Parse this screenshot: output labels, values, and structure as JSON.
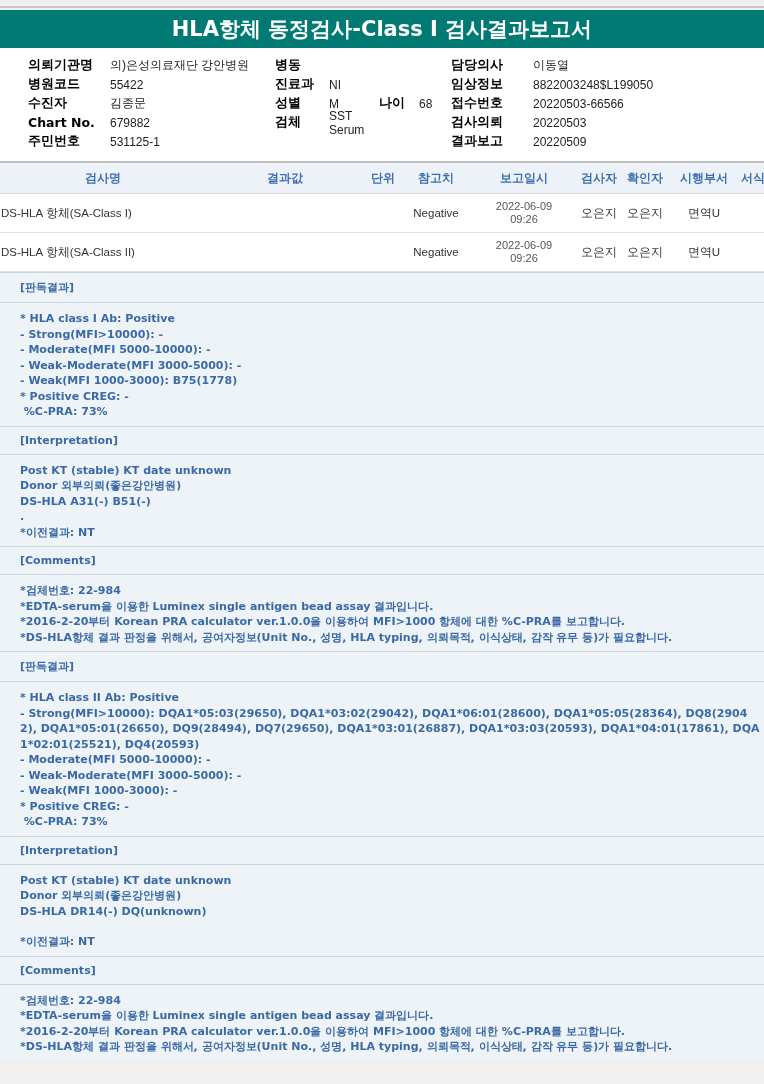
{
  "title": "HLA항체 동정검사-Class I 검사결과보고서",
  "info_rows": [
    {
      "left": {
        "label": "의뢰기관명",
        "value": "의)은성의료재단 강안병원"
      },
      "middle": {
        "label": "병동"
      },
      "right": {
        "label": "담당의사",
        "value": "이동열"
      }
    },
    {
      "left": {
        "label": "병원코드",
        "value": "55422"
      },
      "middle": {
        "label": "진료과",
        "value": "NI"
      },
      "right": {
        "label": "임상정보",
        "value": "8822003248$L199050"
      }
    },
    {
      "left": {
        "label": "수진자",
        "value": "김종문"
      },
      "middle": {
        "label": "성별",
        "value": "M",
        "extra": {
          "label": "나이",
          "value": "68"
        }
      },
      "right": {
        "label": "접수번호",
        "value": "20220503-66566"
      }
    },
    {
      "left": {
        "label": "Chart No.",
        "value": "679882"
      },
      "middle": {
        "label": "검체",
        "value": "SST Serum"
      },
      "right": {
        "label": "검사의뢰",
        "value": "20220503"
      }
    },
    {
      "left": {
        "label": "주민번호",
        "value": "531125-1"
      },
      "right": {
        "label": "결과보고",
        "value": "20220509"
      }
    }
  ],
  "table": {
    "columns": [
      "검사명",
      "결과값",
      "단위",
      "참고치",
      "보고일시",
      "검사자",
      "확인자",
      "시행부서",
      "서식"
    ],
    "rows": [
      {
        "name": "DS-HLA 항체(SA-Class I)",
        "reference": "Negative",
        "date": "2022-06-09",
        "time": "09:26",
        "tester": "오은지",
        "confirmer": "오은지",
        "department": "면역U"
      },
      {
        "name": "DS-HLA 항체(SA-Class II)",
        "reference": "Negative",
        "date": "2022-06-09",
        "time": "09:26",
        "tester": "오은지",
        "confirmer": "오은지",
        "department": "면역U"
      }
    ]
  },
  "sections": [
    {
      "heading": "[판독결과]",
      "paragraphs": [
        [
          "* HLA class I Ab: Positive",
          "- Strong(MFI>10000): -",
          "- Moderate(MFI 5000-10000): -",
          "- Weak-Moderate(MFI 3000-5000): -",
          "- Weak(MFI 1000-3000): B75(1778)",
          "* Positive CREG: -",
          " %C-PRA: 73%"
        ]
      ]
    },
    {
      "heading": "[Interpretation]",
      "paragraphs": [
        [
          "Post KT (stable) KT date unknown",
          "Donor 외부의뢰(좋은강안병원)",
          "DS-HLA A31(-) B51(-)",
          ".",
          "*이전결과: NT"
        ]
      ]
    },
    {
      "heading": "[Comments]",
      "paragraphs": [
        [
          "*검체번호: 22-984",
          "*EDTA-serum을 이용한 Luminex single antigen bead assay 결과입니다.",
          "*2016-2-20부터 Korean PRA calculator ver.1.0.0을 이용하여 MFI>1000 항체에 대한 %C-PRA를 보고합니다.",
          "*DS-HLA항체 결과 판정을 위해서, 공여자정보(Unit No., 성명, HLA typing, 의뢰목적, 이식상태, 감작 유무 등)가 필요합니다."
        ]
      ]
    },
    {
      "heading": "[판독결과]",
      "paragraphs": [
        [
          "* HLA class II Ab: Positive",
          "- Strong(MFI>10000): DQA1*05:03(29650), DQA1*03:02(29042), DQA1*06:01(28600), DQA1*05:05(28364), DQ8(29042), DQA1*05:01(26650), DQ9(28494), DQ7(29650), DQA1*03:01(26887), DQA1*03:03(20593), DQA1*04:01(17861), DQA1*02:01(25521), DQ4(20593)",
          "- Moderate(MFI 5000-10000): -",
          "- Weak-Moderate(MFI 3000-5000): -",
          "- Weak(MFI 1000-3000): -",
          "* Positive CREG: -",
          " %C-PRA: 73%"
        ]
      ]
    },
    {
      "heading": "[Interpretation]",
      "paragraphs": [
        [
          "Post KT (stable) KT date unknown",
          "Donor 외부의뢰(좋은강안병원)",
          "DS-HLA DR14(-) DQ(unknown)"
        ],
        [
          "*이전결과: NT"
        ]
      ]
    },
    {
      "heading": "[Comments]",
      "paragraphs": [
        [
          "*검체번호: 22-984",
          "*EDTA-serum을 이용한 Luminex single antigen bead assay 결과입니다.",
          "*2016-2-20부터 Korean PRA calculator ver.1.0.0을 이용하여 MFI>1000 항체에 대한 %C-PRA를 보고합니다.",
          "*DS-HLA항체 결과 판정을 위해서, 공여자정보(Unit No., 성명, HLA typing, 의뢰목적, 이식상태, 감작 유무 등)가 필요합니다."
        ]
      ]
    }
  ]
}
